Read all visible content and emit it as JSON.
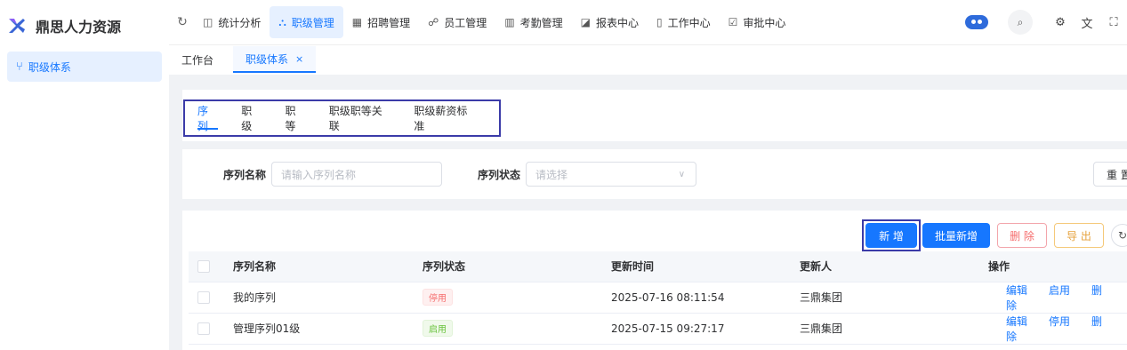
{
  "app": {
    "title": "鼎思人力资源"
  },
  "sidebar": {
    "items": [
      {
        "label": "职级体系"
      }
    ]
  },
  "nav": {
    "items": [
      {
        "label": "统计分析",
        "icon": "chart-icon"
      },
      {
        "label": "职级管理",
        "icon": "org-icon",
        "active": true
      },
      {
        "label": "招聘管理",
        "icon": "grid-icon"
      },
      {
        "label": "员工管理",
        "icon": "people-icon"
      },
      {
        "label": "考勤管理",
        "icon": "book-icon"
      },
      {
        "label": "报表中心",
        "icon": "report-icon"
      },
      {
        "label": "工作中心",
        "icon": "doc-icon"
      },
      {
        "label": "审批中心",
        "icon": "check-icon"
      }
    ]
  },
  "pagetabs": {
    "home": "工作台",
    "current": "职级体系"
  },
  "subtabs": [
    "序列",
    "职级",
    "职等",
    "职级职等关联",
    "职级薪资标准"
  ],
  "filter": {
    "name_label": "序列名称",
    "name_placeholder": "请输入序列名称",
    "status_label": "序列状态",
    "status_placeholder": "请选择",
    "reset": "重 置"
  },
  "actions": {
    "add": "新 增",
    "batch_add": "批量新增",
    "delete": "删 除",
    "export": "导 出"
  },
  "table": {
    "columns": [
      "序列名称",
      "序列状态",
      "更新时间",
      "更新人",
      "操作"
    ],
    "rows": [
      {
        "name": "我的序列",
        "status": "停用",
        "updated": "2025-07-16 08:11:54",
        "updater": "三鼎集团",
        "ops": [
          "编辑",
          "启用",
          "删除"
        ]
      },
      {
        "name": "管理序列01级",
        "status": "启用",
        "updated": "2025-07-15 09:27:17",
        "updater": "三鼎集团",
        "ops": [
          "编辑",
          "停用",
          "删除"
        ]
      }
    ]
  },
  "colors": {
    "primary": "#1677ff",
    "danger": "#f56c6c",
    "warning": "#e6a23c",
    "success": "#67c23a"
  }
}
